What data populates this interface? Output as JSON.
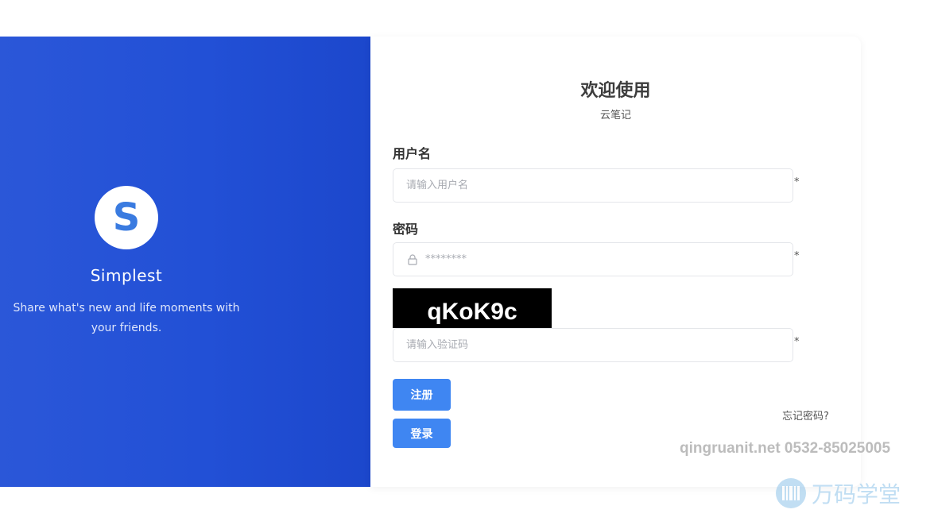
{
  "brand": {
    "logo_letter": "S",
    "name": "Simplest",
    "tagline": "Share what's new and life moments with your friends."
  },
  "form": {
    "title": "欢迎使用",
    "subtitle": "云笔记",
    "username": {
      "label": "用户名",
      "placeholder": "请输入用户名",
      "required_mark": "*"
    },
    "password": {
      "label": "密码",
      "placeholder": "********",
      "required_mark": "*",
      "icon": "lock-icon"
    },
    "captcha": {
      "code": "qKoK9c",
      "placeholder": "请输入验证码",
      "required_mark": "*"
    },
    "register_label": "注册",
    "login_label": "登录",
    "forgot_label": "忘记密码?"
  },
  "watermark": {
    "text": "qingruanit.net 0532-85025005",
    "logo_text": "万码学堂",
    "logo_icon": "barcode-icon"
  },
  "colors": {
    "brand_blue": "#2250d6",
    "button_blue": "#3f86f2",
    "logo_s": "#3a7be0"
  }
}
